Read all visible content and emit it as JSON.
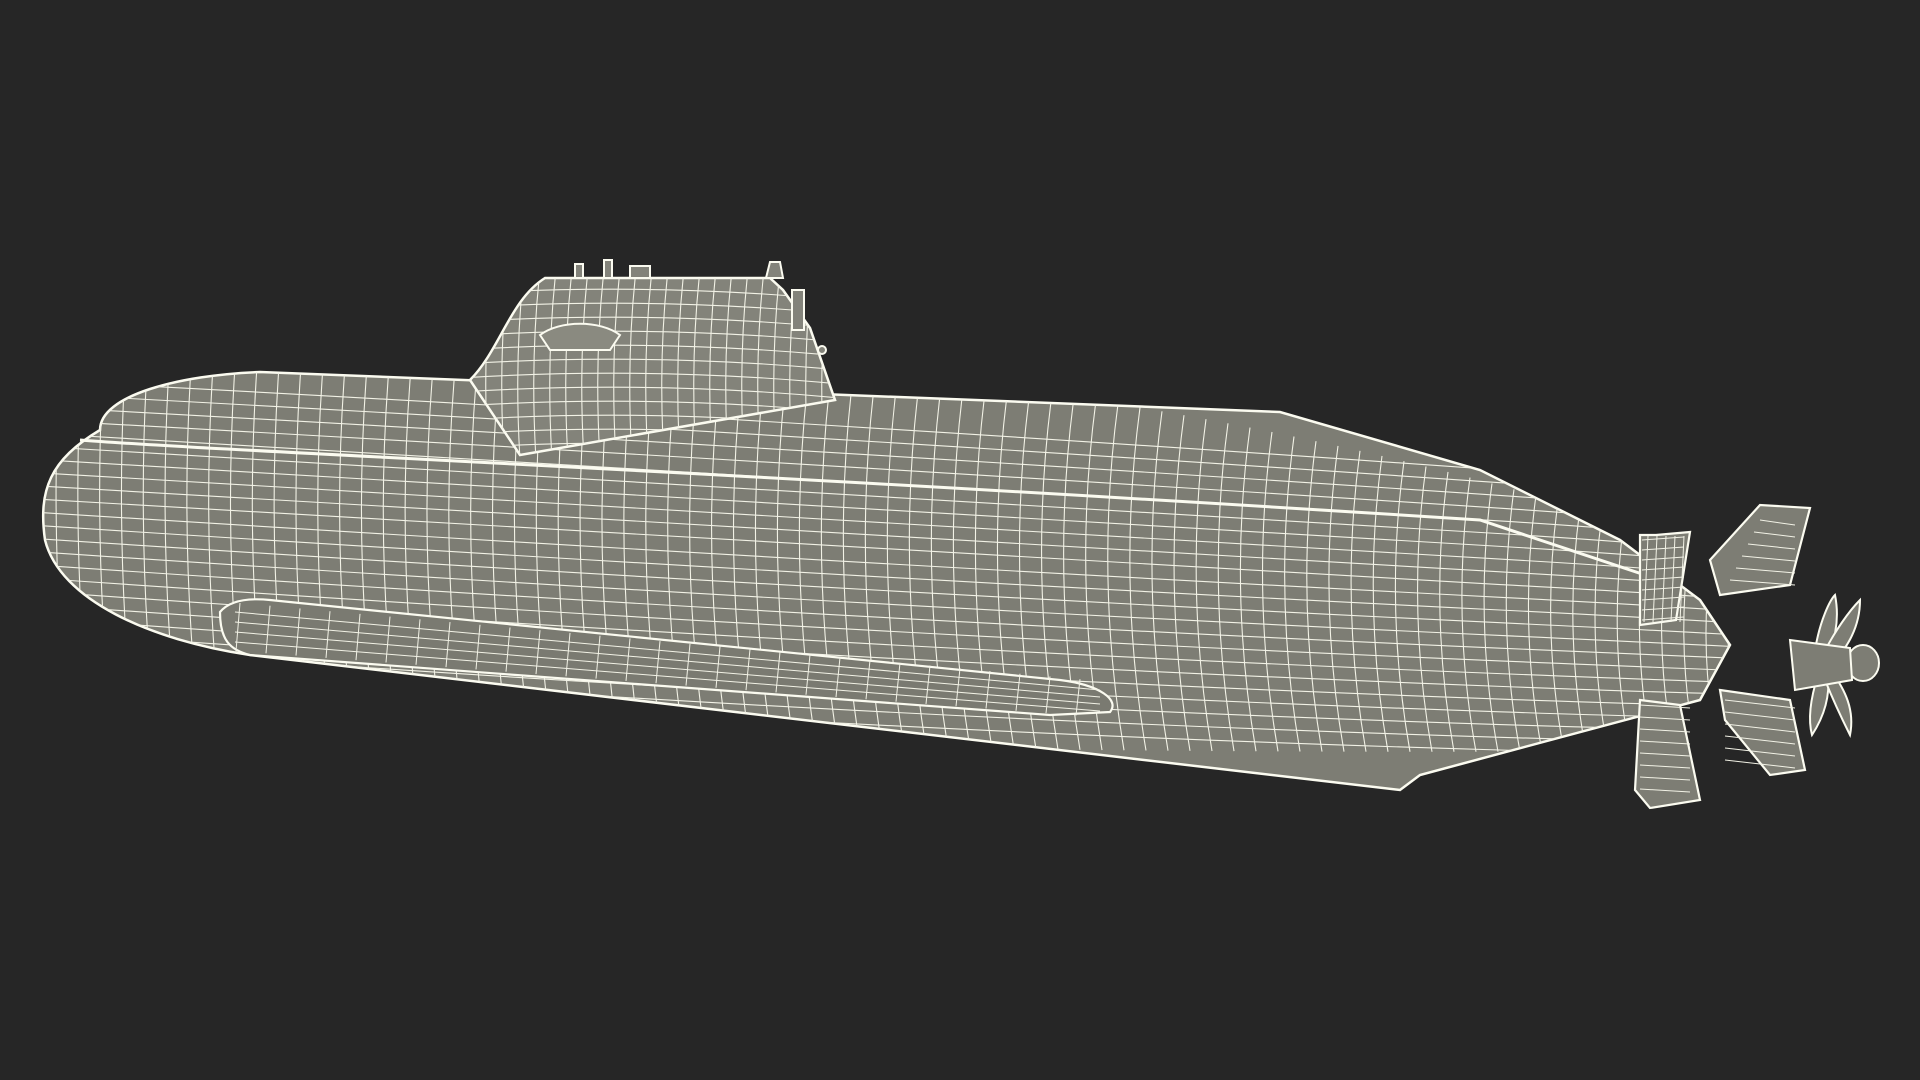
{
  "scene": {
    "subject": "submarine-wireframe-model",
    "background_color": "#262626",
    "surface_color": "#7d7d74",
    "wire_color": "#f2f2e6",
    "outline_color": "#fbfbf0"
  }
}
